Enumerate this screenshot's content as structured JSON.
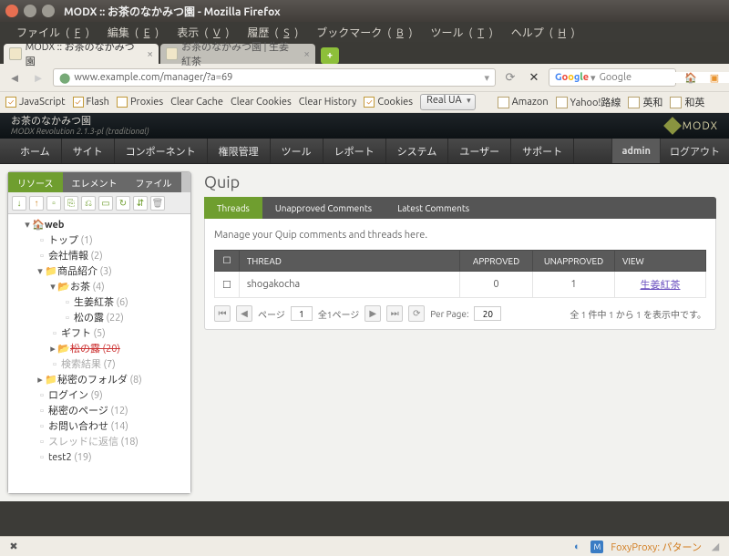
{
  "window": {
    "title": "MODX :: お茶のなかみつ園 - Mozilla Firefox"
  },
  "menubar": {
    "file": "ファイル",
    "file_k": "F",
    "edit": "編集",
    "edit_k": "E",
    "view": "表示",
    "view_k": "V",
    "history": "履歴",
    "history_k": "S",
    "bookmarks": "ブックマーク",
    "bookmarks_k": "B",
    "tools": "ツール",
    "tools_k": "T",
    "help": "ヘルプ",
    "help_k": "H"
  },
  "tabs": {
    "t1": "MODX :: お茶のなかみつ園",
    "t2": "お茶のなかみつ園 | 生姜紅茶"
  },
  "url": {
    "value": "www.example.com/manager/?a=69"
  },
  "search": {
    "placeholder": "Google"
  },
  "addonbar": {
    "javascript": "JavaScript",
    "flash": "Flash",
    "proxies": "Proxies",
    "clearcache": "Clear Cache",
    "clearcookies": "Clear Cookies",
    "clearhistory": "Clear History",
    "cookies": "Cookies",
    "ua": "Real UA",
    "amazon": "Amazon",
    "yahoo": "Yahoo!路線",
    "eiwa": "英和",
    "waei": "和英"
  },
  "modx": {
    "site": "お茶のなかみつ園",
    "version": "MODX Revolution 2.1.3-pl (traditional)",
    "logo": "MODX",
    "nav": {
      "home": "ホーム",
      "site": "サイト",
      "components": "コンポーネント",
      "security": "権限管理",
      "tools": "ツール",
      "reports": "レポート",
      "system": "システム",
      "users": "ユーザー",
      "support": "サポート"
    },
    "user": "admin",
    "logout": "ログアウト"
  },
  "left": {
    "tab_resources": "リソース",
    "tab_elements": "エレメント",
    "tab_files": "ファイル",
    "tree": {
      "root": "web",
      "top": "トップ",
      "top_n": "(1)",
      "company": "会社情報",
      "company_n": "(2)",
      "products": "商品紹介",
      "products_n": "(3)",
      "tea": "お茶",
      "tea_n": "(4)",
      "ginger": "生姜紅茶",
      "ginger_n": "(6)",
      "matsu": "松の露",
      "matsu_n": "(22)",
      "gift": "ギフト",
      "gift_n": "(5)",
      "matsu2": "松の露",
      "matsu2_n": "(20)",
      "search": "検索結果",
      "search_n": "(7)",
      "secret": "秘密のフォルダ",
      "secret_n": "(8)",
      "login": "ログイン",
      "login_n": "(9)",
      "secretpage": "秘密のページ",
      "secretpage_n": "(12)",
      "contact": "お問い合わせ",
      "contact_n": "(14)",
      "thread": "スレッドに返信",
      "thread_n": "(18)",
      "test2": "test2",
      "test2_n": "(19)"
    }
  },
  "content": {
    "title": "Quip",
    "tab_threads": "Threads",
    "tab_unapproved": "Unapproved Comments",
    "tab_latest": "Latest Comments",
    "desc": "Manage your Quip comments and threads here.",
    "th_thread": "THREAD",
    "th_approved": "APPROVED",
    "th_unapproved": "UNAPPROVED",
    "th_view": "VIEW",
    "row": {
      "thread": "shogakocha",
      "approved": "0",
      "unapproved": "1",
      "view": "生姜紅茶"
    },
    "pager": {
      "page_label": "ページ",
      "page": "1",
      "total": "全1ページ",
      "perpage_label": "Per Page:",
      "perpage": "20",
      "status": "全 1 件中 1 から 1 を表示中です。"
    }
  },
  "statusbar": {
    "foxyproxy": "FoxyProxy: パターン"
  }
}
